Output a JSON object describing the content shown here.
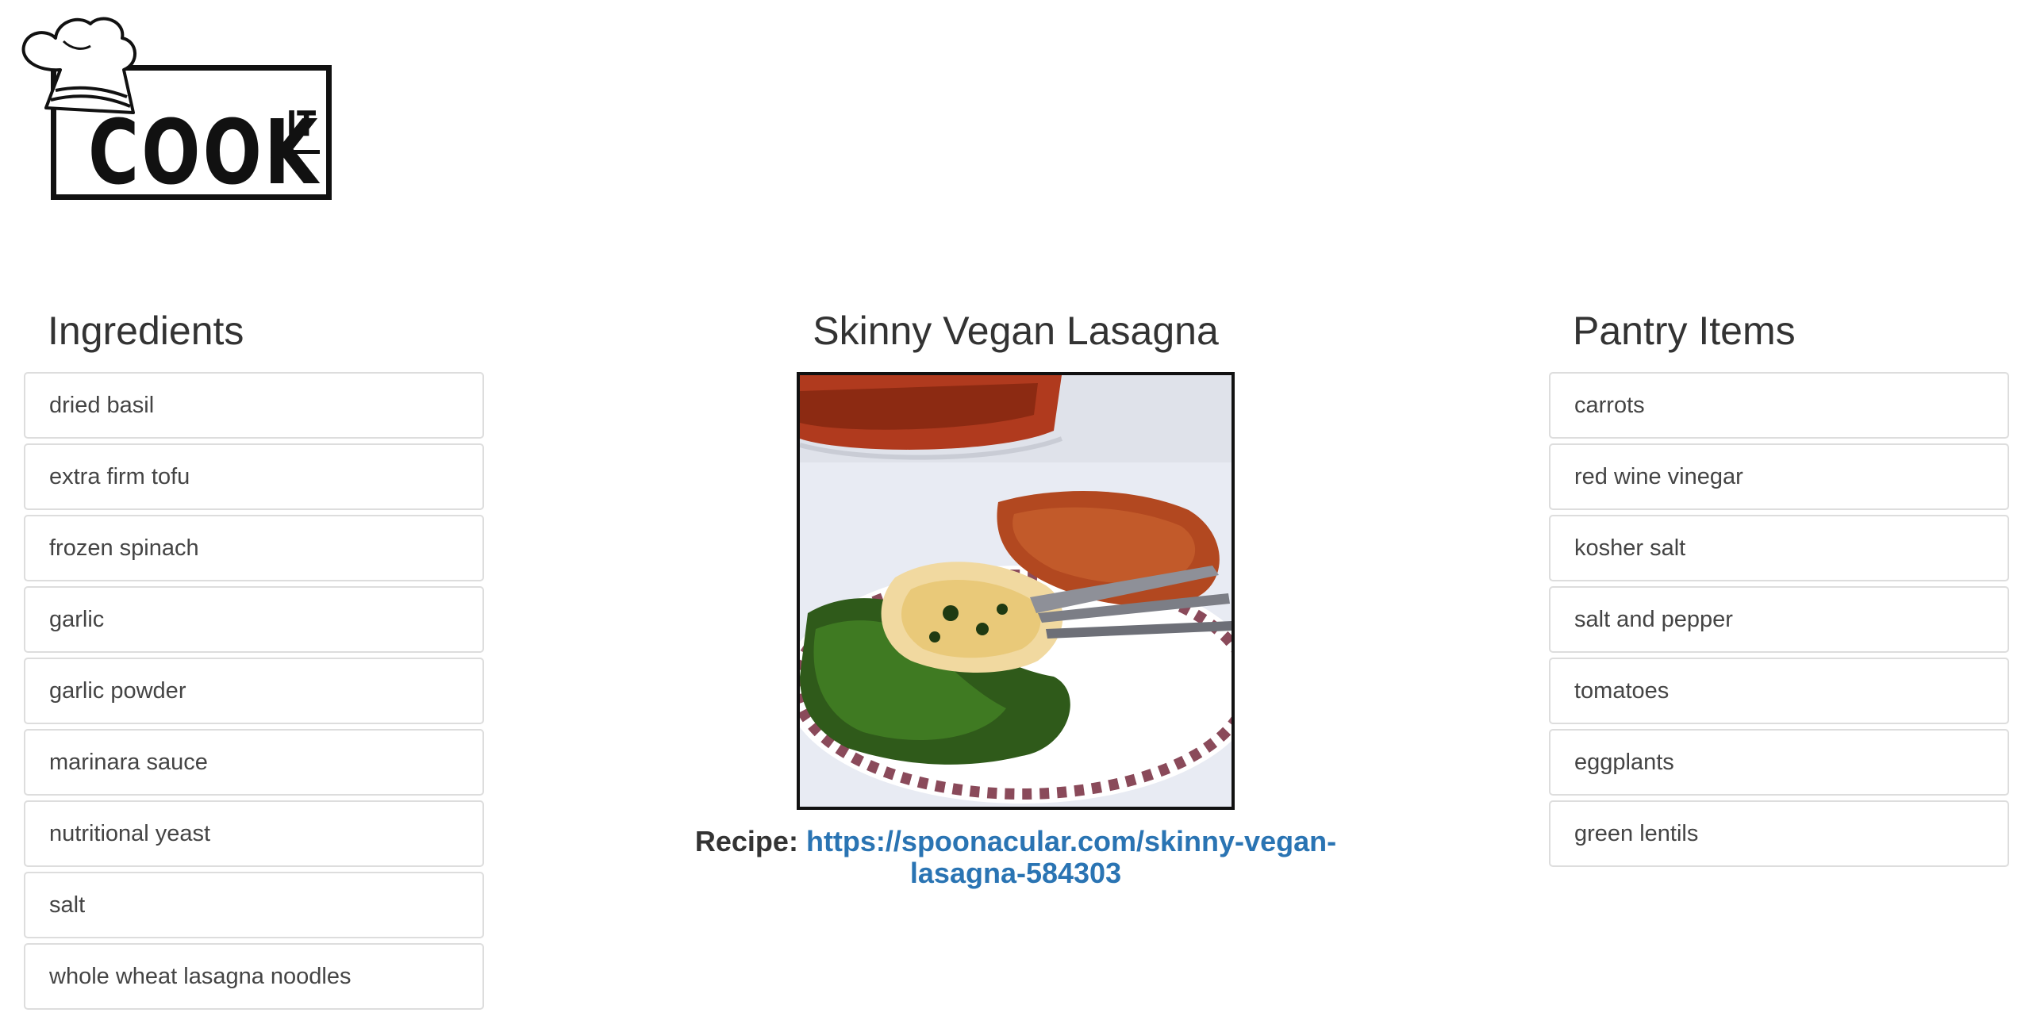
{
  "logo": {
    "word": "COOK",
    "superscript": "IT"
  },
  "ingredients": {
    "title": "Ingredients",
    "items": [
      "dried basil",
      "extra firm tofu",
      "frozen spinach",
      "garlic",
      "garlic powder",
      "marinara sauce",
      "nutritional yeast",
      "salt",
      "whole wheat lasagna noodles"
    ]
  },
  "recipe": {
    "title": "Skinny Vegan Lasagna",
    "label": "Recipe:",
    "url_line1": "https://spoonacular.com/skinny-vegan-",
    "url_line2": "lasagna-584303",
    "url": "https://spoonacular.com/skinny-vegan-lasagna-584303"
  },
  "pantry": {
    "title": "Pantry Items",
    "items": [
      "carrots",
      "red wine vinegar",
      "kosher salt",
      "salt and pepper",
      "tomatoes",
      "eggplants",
      "green lentils"
    ]
  },
  "colors": {
    "link": "#2a74b3",
    "border": "#dddddd",
    "text": "#333333"
  }
}
